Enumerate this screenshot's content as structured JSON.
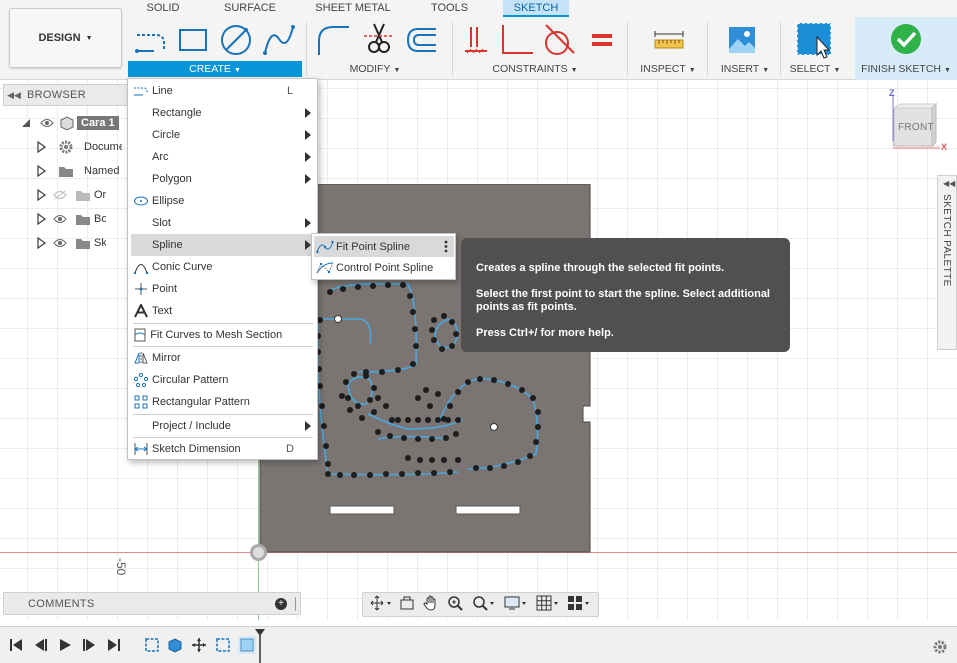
{
  "workspace": {
    "label": "DESIGN"
  },
  "tabs": [
    {
      "label": "SOLID",
      "active": false
    },
    {
      "label": "SURFACE",
      "active": false
    },
    {
      "label": "SHEET METAL",
      "active": false
    },
    {
      "label": "TOOLS",
      "active": false
    },
    {
      "label": "SKETCH",
      "active": true
    }
  ],
  "groups": {
    "create": "CREATE",
    "modify": "MODIFY",
    "constraints": "CONSTRAINTS",
    "inspect": "INSPECT",
    "insert": "INSERT",
    "select": "SELECT",
    "finish": "FINISH SKETCH"
  },
  "colors": {
    "accent": "#0696d7",
    "finish_green": "#2fb24a",
    "spline": "#4aa8e0",
    "part_fill": "#7a7572"
  },
  "browser": {
    "title": "BROWSER",
    "items": [
      {
        "label": "Cara 1",
        "icon": "component-icon"
      },
      {
        "label": "Document Settings",
        "icon": "gear-icon"
      },
      {
        "label": "Named Views",
        "icon": "folder-icon"
      },
      {
        "label": "Origin",
        "icon": "folder-icon"
      },
      {
        "label": "Bodies",
        "icon": "folder-icon"
      },
      {
        "label": "Sketches",
        "icon": "folder-icon"
      }
    ]
  },
  "create_menu": {
    "items": [
      {
        "label": "Line",
        "shortcut": "L"
      },
      {
        "label": "Rectangle"
      },
      {
        "label": "Circle"
      },
      {
        "label": "Arc"
      },
      {
        "label": "Polygon"
      },
      {
        "label": "Ellipse"
      },
      {
        "label": "Slot"
      },
      {
        "label": "Spline"
      },
      {
        "label": "Conic Curve"
      },
      {
        "label": "Point"
      },
      {
        "label": "Text"
      },
      {
        "label": "Fit Curves to Mesh Section"
      },
      {
        "label": "Mirror"
      },
      {
        "label": "Circular Pattern"
      },
      {
        "label": "Rectangular Pattern"
      },
      {
        "label": "Project / Include"
      },
      {
        "label": "Sketch Dimension",
        "shortcut": "D"
      }
    ]
  },
  "spline_menu": {
    "items": [
      {
        "label": "Fit Point Spline"
      },
      {
        "label": "Control Point Spline"
      }
    ]
  },
  "tooltip": {
    "line1": "Creates a spline through the selected fit points.",
    "line2": "Select the first point to start the spline. Select additional points as fit points.",
    "line3": "Press Ctrl+/ for more help."
  },
  "palette": {
    "label": "SKETCH PALETTE"
  },
  "viewcube": {
    "face": "FRONT",
    "z": "Z",
    "x": "X"
  },
  "canvas": {
    "dimension": "-50"
  },
  "comments": {
    "title": "COMMENTS"
  }
}
